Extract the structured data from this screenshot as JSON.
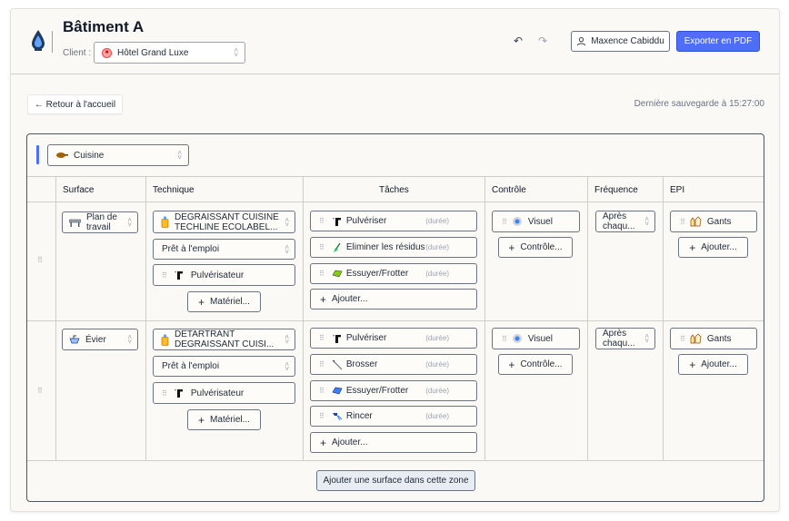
{
  "header": {
    "title": "Bâtiment A",
    "client_label": "Client :",
    "client_value": "Hôtel Grand Luxe",
    "user_name": "Maxence Cabiddu",
    "export_label": "Exporter en PDF"
  },
  "toolbar": {
    "back_label": "← Retour à l'accueil",
    "last_save": "Dernière sauvegarde à 15:27:00"
  },
  "zone": {
    "name": "Cuisine",
    "columns": [
      "Surface",
      "Technique",
      "Tâches",
      "Contrôle",
      "Fréquence",
      "EPI"
    ],
    "add_surface_label": "Ajouter une surface dans cette zone",
    "rows": [
      {
        "surface": "Plan de travail",
        "surface_line1": "Plan de",
        "surface_line2": "travail",
        "technique_line1": "DEGRAISSANT CUISINE",
        "technique_line2": "TECHLINE ECOLABEL...",
        "dilution": "Prêt à l'emploi",
        "material": "Pulvérisateur",
        "add_material": "Matériel...",
        "tasks": [
          {
            "name": "Pulvériser",
            "duration": "(durée)"
          },
          {
            "name": "Eliminer les résidus",
            "duration": "(durée)"
          },
          {
            "name": "Essuyer/Frotter",
            "duration": "(durée)"
          }
        ],
        "add_task": "Ajouter...",
        "control": "Visuel",
        "add_control": "Contrôle...",
        "frequency_line1": "Après",
        "frequency_line2": "chaqu...",
        "epi": "Gants",
        "add_epi": "Ajouter..."
      },
      {
        "surface": "Évier",
        "technique_line1": "DETARTRANT",
        "technique_line2": "DEGRAISSANT CUISI...",
        "dilution": "Prêt à l'emploi",
        "material": "Pulvérisateur",
        "add_material": "Matériel...",
        "tasks": [
          {
            "name": "Pulvériser",
            "duration": "(durée)"
          },
          {
            "name": "Brosser",
            "duration": "(durée)"
          },
          {
            "name": "Essuyer/Frotter",
            "duration": "(durée)"
          },
          {
            "name": "Rincer",
            "duration": "(durée)"
          }
        ],
        "add_task": "Ajouter...",
        "control": "Visuel",
        "add_control": "Contrôle...",
        "frequency_line1": "Après",
        "frequency_line2": "chaqu...",
        "epi": "Gants",
        "add_epi": "Ajouter..."
      }
    ]
  },
  "colors": {
    "accent": "#4f6ef7",
    "border": "#6b7280",
    "background": "#faf9f6"
  }
}
